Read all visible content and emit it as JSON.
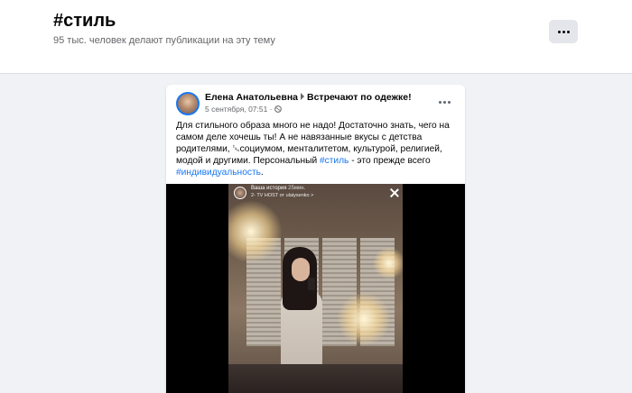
{
  "hashtag": {
    "title": "#стиль",
    "subtitle": "95 тыс. человек делают публикации на эту тему"
  },
  "post": {
    "author": "Елена Анатольевна",
    "group": "Встречают по одежке!",
    "date": "5 сентября, 07:51",
    "date_separator": "·",
    "text_part1": "Для стильного образа много не надо! Достаточно знать, чего на самом деле хочешь ты! А не навязанные вкусы с детства родителями, ␘социумом, менталитетом, культурой, религией, модой и другими. Персональный ",
    "tag1": "#стиль",
    "text_part2": " - это прежде всего ",
    "tag2": "#индивидуальность",
    "text_part3": "."
  },
  "story": {
    "title": "Ваша история",
    "time": "25мин.",
    "subtitle": "2- TV HOST от ulaiysenko >"
  },
  "colors": {
    "link": "#1877f2",
    "background": "#f0f2f5",
    "secondary_text": "#65676b"
  },
  "icons": [
    "more-horizontal-icon",
    "globe-icon",
    "close-icon",
    "caret-right-icon"
  ]
}
